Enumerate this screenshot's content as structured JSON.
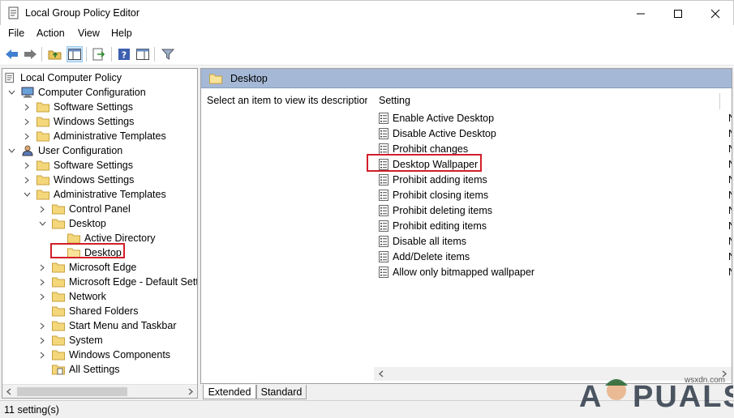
{
  "window": {
    "title": "Local Group Policy Editor"
  },
  "menu": {
    "items": [
      "File",
      "Action",
      "View",
      "Help"
    ]
  },
  "toolbar": {
    "icons": [
      "back-arrow-icon",
      "forward-arrow-icon",
      "up-folder-icon",
      "show-hide-tree-icon",
      "export-list-icon",
      "help-icon",
      "properties-pane-icon",
      "filter-icon"
    ]
  },
  "tree": {
    "root": "Local Computer Policy",
    "computer_config": "Computer Configuration",
    "cc_software": "Software Settings",
    "cc_windows": "Windows Settings",
    "cc_admin": "Administrative Templates",
    "user_config": "User Configuration",
    "uc_software": "Software Settings",
    "uc_windows": "Windows Settings",
    "uc_admin": "Administrative Templates",
    "control_panel": "Control Panel",
    "desktop": "Desktop",
    "active_directory": "Active Directory",
    "desktop_sub": "Desktop",
    "microsoft_edge": "Microsoft Edge",
    "edge_default": "Microsoft Edge - Default Settings",
    "network": "Network",
    "shared_folders": "Shared Folders",
    "start_menu": "Start Menu and Taskbar",
    "system": "System",
    "windows_components": "Windows Components",
    "all_settings": "All Settings"
  },
  "right_pane": {
    "header": "Desktop",
    "description": "Select an item to view its description.",
    "column_setting": "Setting",
    "state_letter": "N",
    "settings": [
      "Enable Active Desktop",
      "Disable Active Desktop",
      "Prohibit changes",
      "Desktop Wallpaper",
      "Prohibit adding items",
      "Prohibit closing items",
      "Prohibit deleting items",
      "Prohibit editing items",
      "Disable all items",
      "Add/Delete items",
      "Allow only bitmapped wallpaper"
    ]
  },
  "tabs": {
    "extended": "Extended",
    "standard": "Standard"
  },
  "status": {
    "text": "11 setting(s)"
  },
  "watermark": {
    "brand": "APPUALS",
    "site": "wsxdn.com"
  },
  "colors": {
    "highlight": "#d21f2a",
    "header_bg": "#a5b9d6",
    "folder": "#f4d77a"
  }
}
